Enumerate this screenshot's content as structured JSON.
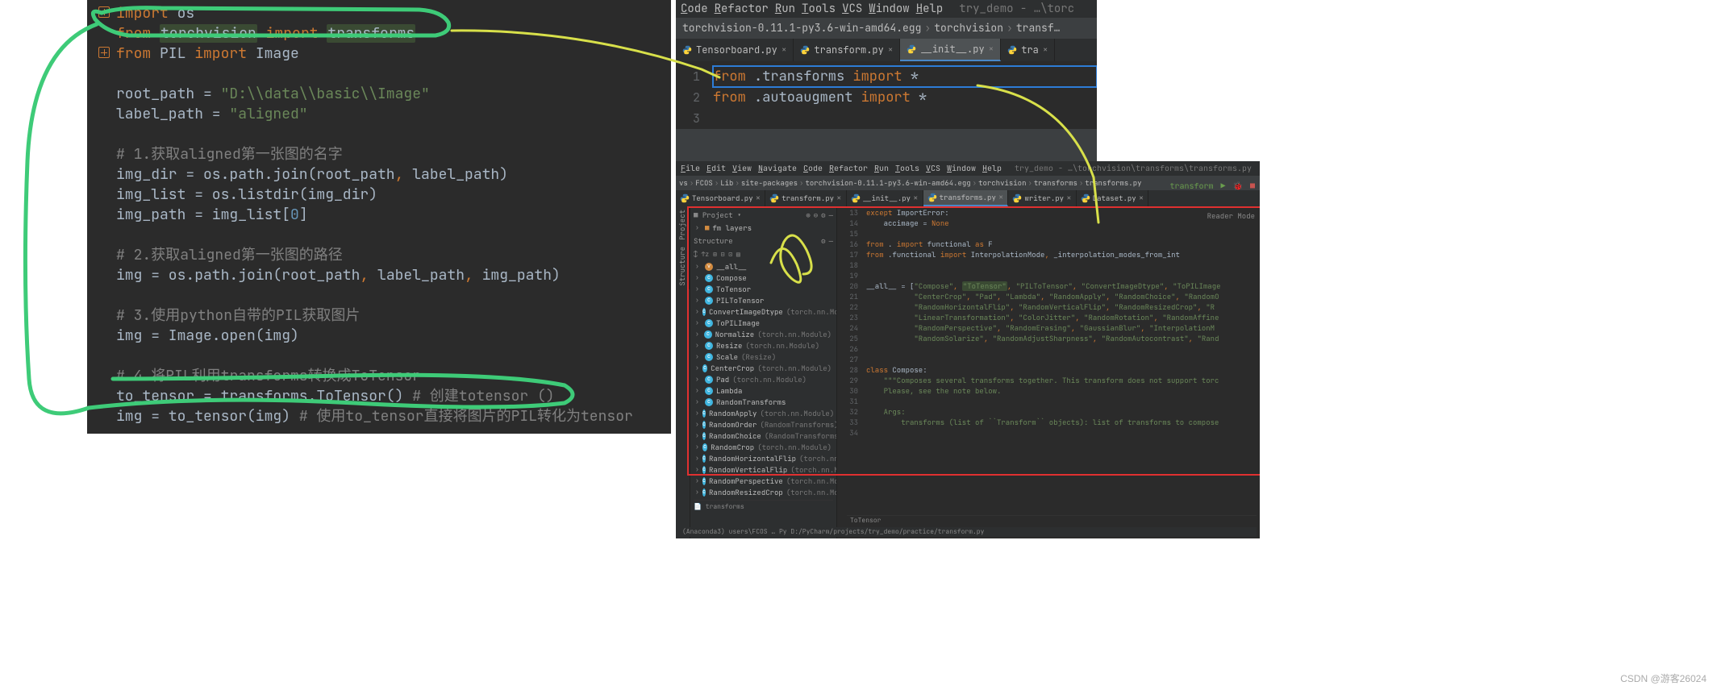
{
  "panelA": {
    "lines": [
      {
        "t": "code",
        "tokens": [
          {
            "c": "kw",
            "s": "import "
          },
          {
            "c": "",
            "s": "os"
          }
        ]
      },
      {
        "t": "code",
        "tokens": [
          {
            "c": "kw",
            "s": "from "
          },
          {
            "c": "hl",
            "s": "torchvision"
          },
          {
            "c": "kw",
            "s": " import "
          },
          {
            "c": "hl",
            "s": "transforms"
          }
        ]
      },
      {
        "t": "code",
        "tokens": [
          {
            "c": "kw",
            "s": "from "
          },
          {
            "c": "",
            "s": "PIL "
          },
          {
            "c": "kw",
            "s": "import "
          },
          {
            "c": "",
            "s": "Image"
          }
        ]
      },
      {
        "t": "blank"
      },
      {
        "t": "code",
        "tokens": [
          {
            "c": "",
            "s": "root_path = "
          },
          {
            "c": "str",
            "s": "\"D:\\\\data\\\\basic\\\\Image\""
          }
        ]
      },
      {
        "t": "code",
        "tokens": [
          {
            "c": "",
            "s": "label_path = "
          },
          {
            "c": "str",
            "s": "\"aligned\""
          }
        ]
      },
      {
        "t": "blank"
      },
      {
        "t": "code",
        "tokens": [
          {
            "c": "cmt",
            "s": "# 1.获取aligned第一张图的名字"
          }
        ]
      },
      {
        "t": "code",
        "tokens": [
          {
            "c": "",
            "s": "img_dir = os.path.join(root_path"
          },
          {
            "c": "kw",
            "s": ", "
          },
          {
            "c": "",
            "s": "label_path)"
          }
        ]
      },
      {
        "t": "code",
        "tokens": [
          {
            "c": "",
            "s": "img_list = os.listdir(img_dir)"
          }
        ]
      },
      {
        "t": "code",
        "tokens": [
          {
            "c": "",
            "s": "img_path = img_list["
          },
          {
            "c": "num",
            "s": "0"
          },
          {
            "c": "",
            "s": "]"
          }
        ]
      },
      {
        "t": "blank"
      },
      {
        "t": "code",
        "tokens": [
          {
            "c": "cmt",
            "s": "# 2.获取aligned第一张图的路径"
          }
        ]
      },
      {
        "t": "code",
        "tokens": [
          {
            "c": "",
            "s": "img = os.path.join(root_path"
          },
          {
            "c": "kw",
            "s": ", "
          },
          {
            "c": "",
            "s": "label_path"
          },
          {
            "c": "kw",
            "s": ", "
          },
          {
            "c": "",
            "s": "img_path)"
          }
        ]
      },
      {
        "t": "blank"
      },
      {
        "t": "code",
        "tokens": [
          {
            "c": "cmt",
            "s": "# 3.使用python自带的PIL获取图片"
          }
        ]
      },
      {
        "t": "code",
        "tokens": [
          {
            "c": "",
            "s": "img = Image.open(img)"
          }
        ]
      },
      {
        "t": "blank"
      },
      {
        "t": "code",
        "tokens": [
          {
            "c": "cmt",
            "s": "# 4.将PIL利用transforms转换成ToTensor"
          }
        ]
      },
      {
        "t": "code",
        "tokens": [
          {
            "c": "",
            "s": "to_tensor = transforms.ToTensor()   "
          },
          {
            "c": "cmt",
            "s": "# 创建totensor ()"
          }
        ]
      },
      {
        "t": "code",
        "tokens": [
          {
            "c": "",
            "s": "img = to_tensor(img)   "
          },
          {
            "c": "cmt",
            "s": "# 使用to_tensor直接将图片的PIL转化为tensor"
          }
        ]
      }
    ]
  },
  "panelB": {
    "menu": [
      "Code",
      "Refactor",
      "Run",
      "Tools",
      "VCS",
      "Window",
      "Help"
    ],
    "menu_extra": "try_demo - …\\torc",
    "breadcrumb": [
      "torchvision-0.11.1-py3.6-win-amd64.egg",
      "torchvision",
      "transf…"
    ],
    "tabs": [
      {
        "label": "Tensorboard.py",
        "active": false
      },
      {
        "label": "transform.py",
        "active": false
      },
      {
        "label": "__init__.py",
        "active": true
      },
      {
        "label": "tra",
        "active": false
      }
    ],
    "lines": [
      {
        "n": "1",
        "tokens": [
          {
            "c": "kw",
            "s": "from "
          },
          {
            "c": "",
            "s": ".transforms "
          },
          {
            "c": "kw",
            "s": "import "
          },
          {
            "c": "",
            "s": "*"
          }
        ],
        "sel": true
      },
      {
        "n": "2",
        "tokens": [
          {
            "c": "kw",
            "s": "from "
          },
          {
            "c": "",
            "s": ".autoaugment "
          },
          {
            "c": "kw",
            "s": "import "
          },
          {
            "c": "",
            "s": "*"
          }
        ]
      },
      {
        "n": "3",
        "tokens": []
      }
    ]
  },
  "panelC": {
    "menu": [
      "File",
      "Edit",
      "View",
      "Navigate",
      "Code",
      "Refactor",
      "Run",
      "Tools",
      "VCS",
      "Window",
      "Help"
    ],
    "menu_extra": "try_demo - …\\torchvision\\transforms\\transforms.py",
    "breadcrumb": [
      "vs",
      "FCOS",
      "Lib",
      "site-packages",
      "torchvision-0.11.1-py3.6-win-amd64.egg",
      "torchvision",
      "transforms",
      "transforms.py"
    ],
    "run_config": "transform",
    "sidelabel_project": "Project",
    "sidelabel_structure": "Structure",
    "project_collapsed": "fm layers",
    "tabs": [
      {
        "label": "Tensorboard.py",
        "active": false
      },
      {
        "label": "transform.py",
        "active": false
      },
      {
        "label": "__init__.py",
        "active": false
      },
      {
        "label": "transforms.py",
        "active": true
      },
      {
        "label": "writer.py",
        "active": false
      },
      {
        "label": "Dataset.py",
        "active": false
      }
    ],
    "structure_title": "Structure",
    "structure": [
      {
        "k": "orange",
        "name": "__all__"
      },
      {
        "k": "blue",
        "name": "Compose"
      },
      {
        "k": "blue",
        "name": "ToTensor"
      },
      {
        "k": "blue",
        "name": "PILToTensor"
      },
      {
        "k": "blue",
        "name": "ConvertImageDtype",
        "ext": "(torch.nn.Module)"
      },
      {
        "k": "blue",
        "name": "ToPILImage"
      },
      {
        "k": "blue",
        "name": "Normalize",
        "ext": "(torch.nn.Module)"
      },
      {
        "k": "blue",
        "name": "Resize",
        "ext": "(torch.nn.Module)"
      },
      {
        "k": "blue",
        "name": "Scale",
        "ext": "(Resize)"
      },
      {
        "k": "blue",
        "name": "CenterCrop",
        "ext": "(torch.nn.Module)"
      },
      {
        "k": "blue",
        "name": "Pad",
        "ext": "(torch.nn.Module)"
      },
      {
        "k": "blue",
        "name": "Lambda"
      },
      {
        "k": "blue",
        "name": "RandomTransforms"
      },
      {
        "k": "blue",
        "name": "RandomApply",
        "ext": "(torch.nn.Module)"
      },
      {
        "k": "blue",
        "name": "RandomOrder",
        "ext": "(RandomTransforms)"
      },
      {
        "k": "blue",
        "name": "RandomChoice",
        "ext": "(RandomTransforms)"
      },
      {
        "k": "blue",
        "name": "RandomCrop",
        "ext": "(torch.nn.Module)"
      },
      {
        "k": "blue",
        "name": "RandomHorizontalFlip",
        "ext": "(torch.nn.Module)"
      },
      {
        "k": "blue",
        "name": "RandomVerticalFlip",
        "ext": "(torch.nn.Module)"
      },
      {
        "k": "blue",
        "name": "RandomPerspective",
        "ext": "(torch.nn.Module)"
      },
      {
        "k": "blue",
        "name": "RandomResizedCrop",
        "ext": "(torch.nn.Module)"
      }
    ],
    "structure_bc": "transforms",
    "reader_mode": "Reader Mode",
    "code": [
      {
        "n": "13",
        "tokens": [
          {
            "c": "kw",
            "s": "except "
          },
          {
            "c": "",
            "s": "ImportError:"
          }
        ]
      },
      {
        "n": "14",
        "tokens": [
          {
            "c": "",
            "s": "    accimage = "
          },
          {
            "c": "kw",
            "s": "None"
          }
        ]
      },
      {
        "n": "15",
        "tokens": []
      },
      {
        "n": "16",
        "tokens": [
          {
            "c": "kw",
            "s": "from "
          },
          {
            "c": "",
            "s": ". "
          },
          {
            "c": "kw",
            "s": "import "
          },
          {
            "c": "",
            "s": "functional "
          },
          {
            "c": "kw",
            "s": "as "
          },
          {
            "c": "",
            "s": "F"
          }
        ]
      },
      {
        "n": "17",
        "tokens": [
          {
            "c": "kw",
            "s": "from "
          },
          {
            "c": "",
            "s": ".functional "
          },
          {
            "c": "kw",
            "s": "import "
          },
          {
            "c": "",
            "s": "InterpolationMode"
          },
          {
            "c": "kw",
            "s": ", "
          },
          {
            "c": "",
            "s": "_interpolation_modes_from_int"
          }
        ]
      },
      {
        "n": "18",
        "tokens": []
      },
      {
        "n": "19",
        "tokens": []
      },
      {
        "n": "20",
        "tokens": [
          {
            "c": "",
            "s": "__all__ = ["
          },
          {
            "c": "str",
            "s": "\"Compose\""
          },
          {
            "c": "kw",
            "s": ", "
          },
          {
            "c": "str hl",
            "s": "\"ToTensor\""
          },
          {
            "c": "kw",
            "s": ", "
          },
          {
            "c": "str",
            "s": "\"PILToTensor\""
          },
          {
            "c": "kw",
            "s": ", "
          },
          {
            "c": "str",
            "s": "\"ConvertImageDtype\""
          },
          {
            "c": "kw",
            "s": ", "
          },
          {
            "c": "str",
            "s": "\"ToPILImage"
          }
        ]
      },
      {
        "n": "21",
        "tokens": [
          {
            "c": "",
            "s": "           "
          },
          {
            "c": "str",
            "s": "\"CenterCrop\""
          },
          {
            "c": "kw",
            "s": ", "
          },
          {
            "c": "str",
            "s": "\"Pad\""
          },
          {
            "c": "kw",
            "s": ", "
          },
          {
            "c": "str",
            "s": "\"Lambda\""
          },
          {
            "c": "kw",
            "s": ", "
          },
          {
            "c": "str",
            "s": "\"RandomApply\""
          },
          {
            "c": "kw",
            "s": ", "
          },
          {
            "c": "str",
            "s": "\"RandomChoice\""
          },
          {
            "c": "kw",
            "s": ", "
          },
          {
            "c": "str",
            "s": "\"RandomO"
          }
        ]
      },
      {
        "n": "22",
        "tokens": [
          {
            "c": "",
            "s": "           "
          },
          {
            "c": "str",
            "s": "\"RandomHorizontalFlip\""
          },
          {
            "c": "kw",
            "s": ", "
          },
          {
            "c": "str",
            "s": "\"RandomVerticalFlip\""
          },
          {
            "c": "kw",
            "s": ", "
          },
          {
            "c": "str",
            "s": "\"RandomResizedCrop\""
          },
          {
            "c": "kw",
            "s": ", "
          },
          {
            "c": "str",
            "s": "\"R"
          }
        ]
      },
      {
        "n": "23",
        "tokens": [
          {
            "c": "",
            "s": "           "
          },
          {
            "c": "str",
            "s": "\"LinearTransformation\""
          },
          {
            "c": "kw",
            "s": ", "
          },
          {
            "c": "str",
            "s": "\"ColorJitter\""
          },
          {
            "c": "kw",
            "s": ", "
          },
          {
            "c": "str",
            "s": "\"RandomRotation\""
          },
          {
            "c": "kw",
            "s": ", "
          },
          {
            "c": "str",
            "s": "\"RandomAffine"
          }
        ]
      },
      {
        "n": "24",
        "tokens": [
          {
            "c": "",
            "s": "           "
          },
          {
            "c": "str",
            "s": "\"RandomPerspective\""
          },
          {
            "c": "kw",
            "s": ", "
          },
          {
            "c": "str",
            "s": "\"RandomErasing\""
          },
          {
            "c": "kw",
            "s": ", "
          },
          {
            "c": "str",
            "s": "\"GaussianBlur\""
          },
          {
            "c": "kw",
            "s": ", "
          },
          {
            "c": "str",
            "s": "\"InterpolationM"
          }
        ]
      },
      {
        "n": "25",
        "tokens": [
          {
            "c": "",
            "s": "           "
          },
          {
            "c": "str",
            "s": "\"RandomSolarize\""
          },
          {
            "c": "kw",
            "s": ", "
          },
          {
            "c": "str",
            "s": "\"RandomAdjustSharpness\""
          },
          {
            "c": "kw",
            "s": ", "
          },
          {
            "c": "str",
            "s": "\"RandomAutocontrast\""
          },
          {
            "c": "kw",
            "s": ", "
          },
          {
            "c": "str",
            "s": "\"Rand"
          }
        ]
      },
      {
        "n": "26",
        "tokens": []
      },
      {
        "n": "27",
        "tokens": []
      },
      {
        "n": "28",
        "tokens": [
          {
            "c": "kw",
            "s": "class "
          },
          {
            "c": "",
            "s": "Compose:"
          }
        ]
      },
      {
        "n": "29",
        "tokens": [
          {
            "c": "str",
            "s": "    \"\"\"Composes several transforms together. This transform does not support torc"
          }
        ]
      },
      {
        "n": "30",
        "tokens": [
          {
            "c": "str",
            "s": "    Please, see the note below."
          }
        ]
      },
      {
        "n": "31",
        "tokens": []
      },
      {
        "n": "32",
        "tokens": [
          {
            "c": "str",
            "s": "    Args:"
          }
        ]
      },
      {
        "n": "33",
        "tokens": [
          {
            "c": "str",
            "s": "        transforms (list of ``Transform`` objects): list of transforms to compose"
          }
        ]
      },
      {
        "n": "34",
        "tokens": []
      }
    ],
    "bottom_bc": [
      "ToTensor"
    ],
    "terminal_path": "(Anaconda3) users\\FCOS …  Py D:/PyCharm/projects/try_demo/practice/transform.py"
  },
  "watermark": "CSDN @游客26024"
}
